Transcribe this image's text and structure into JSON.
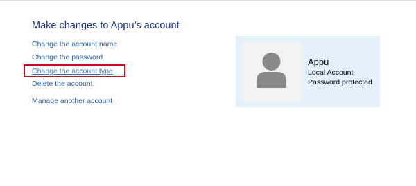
{
  "page": {
    "title": "Make changes to Appu’s account"
  },
  "links": {
    "change_name": "Change the account name",
    "change_password": "Change the password",
    "change_type": "Change the account type",
    "delete_account": "Delete the account",
    "manage_another": "Manage another account"
  },
  "account": {
    "name": "Appu",
    "type": "Local Account",
    "password_status": "Password protected",
    "avatar_icon": "user-silhouette-icon"
  },
  "colors": {
    "title": "#1e3287",
    "link": "#2b61a8",
    "highlight": "#c0101d",
    "card_background": "#e4f0fb",
    "avatar_background": "#f2f2f2",
    "avatar_figure": "#8a8a8a"
  }
}
